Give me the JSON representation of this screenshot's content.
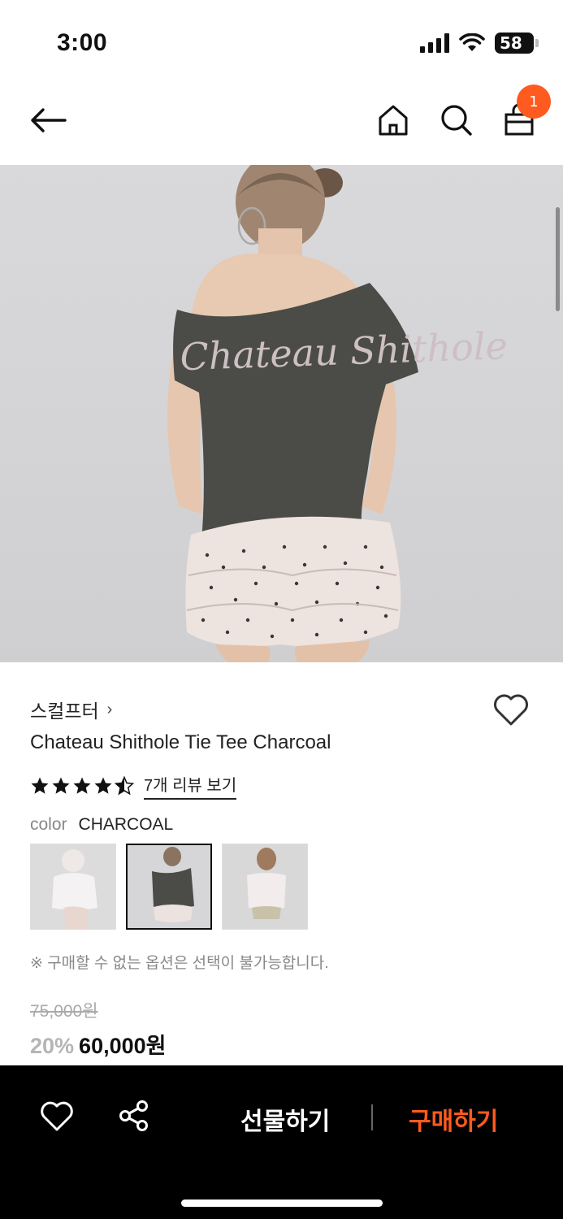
{
  "status_bar": {
    "time": "3:00",
    "battery": "58",
    "icons": [
      "signal-icon",
      "wifi-icon",
      "battery-icon"
    ]
  },
  "nav": {
    "icons": [
      "back-arrow-icon",
      "home-icon",
      "search-icon",
      "shopping-bag-icon"
    ],
    "cart_count": "1"
  },
  "hero": {
    "print_text": "Chateau Shithole"
  },
  "product": {
    "brand": "스컬프터",
    "name": "Chateau Shithole Tie Tee Charcoal",
    "rating": 4.5,
    "review_link": "7개 리뷰 보기",
    "option_label": "color",
    "option_value": "CHARCOAL",
    "swatches": [
      {
        "name": "white",
        "selected": false
      },
      {
        "name": "charcoal",
        "selected": true
      },
      {
        "name": "white-pink",
        "selected": false
      }
    ],
    "notice": "※ 구매할 수 없는 옵션은 선택이 불가능합니다.",
    "original_price": "75,000원",
    "discount": "20%",
    "price": "60,000원"
  },
  "bottom_bar": {
    "gift_label": "선물하기",
    "buy_label": "구매하기",
    "accent_color": "#ff5a1f"
  }
}
